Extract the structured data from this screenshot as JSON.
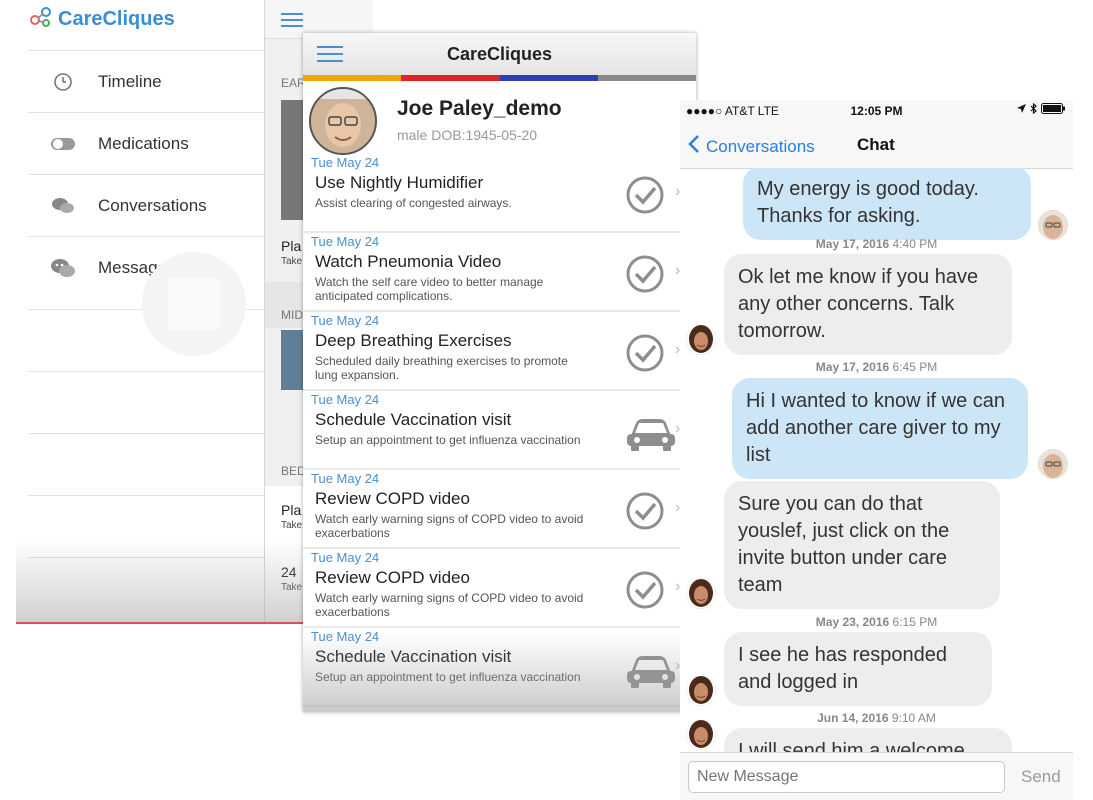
{
  "side_menu": {
    "brand": "CareCliques",
    "items": [
      {
        "label": "Timeline",
        "icon": "clock-icon"
      },
      {
        "label": "Medications",
        "icon": "toggle-icon"
      },
      {
        "label": "Conversations",
        "icon": "chat-bubbles-icon"
      },
      {
        "label": "Messages",
        "icon": "wechat-icon"
      }
    ],
    "background_page": {
      "sections": [
        "EAR",
        "MID",
        "BED"
      ],
      "rows": [
        {
          "title": "Pla",
          "sub": "Take"
        },
        {
          "title": "Pla",
          "sub": "Take"
        },
        {
          "title": "24",
          "sub": "Take"
        }
      ]
    }
  },
  "task_screen": {
    "title": "CareCliques",
    "stripe_colors": [
      "#f0a800",
      "#d9262c",
      "#2e3fb3",
      "#8a8a8a"
    ],
    "patient": {
      "name": "Joe Paley_demo",
      "info": "male  DOB:1945-05-20"
    },
    "tasks": [
      {
        "date": "Tue May 24",
        "title": "Use Nightly Humidifier",
        "desc": "Assist clearing of congested airways.",
        "action": "check-icon"
      },
      {
        "date": "Tue May 24",
        "title": "Watch Pneumonia Video",
        "desc": "Watch the self care video to better manage anticipated complications.",
        "action": "check-icon"
      },
      {
        "date": "Tue May 24",
        "title": "Deep Breathing Exercises",
        "desc": "Scheduled daily breathing exercises to promote lung expansion.",
        "action": "check-icon"
      },
      {
        "date": "Tue May 24",
        "title": "Schedule Vaccination visit",
        "desc": "Setup an appointment to get influenza vaccination",
        "action": "car-icon"
      },
      {
        "date": "Tue May 24",
        "title": "Review COPD video",
        "desc": "Watch early warning signs of COPD video to avoid exacerbations",
        "action": "check-icon"
      },
      {
        "date": "Tue May 24",
        "title": "Review COPD video",
        "desc": "Watch early warning signs of COPD video to avoid exacerbations",
        "action": "check-icon"
      },
      {
        "date": "Tue May 24",
        "title": "Schedule Vaccination visit",
        "desc": "Setup an appointment to get influenza vaccination",
        "action": "car-icon"
      }
    ]
  },
  "chat": {
    "status": {
      "carrier": "●●●●○ AT&T  LTE",
      "time": "12:05 PM"
    },
    "back_label": "Conversations",
    "title": "Chat",
    "messages": [
      {
        "dir": "out",
        "text": "My energy is good today. Thanks for asking."
      },
      {
        "stamp_date": "May 17, 2016",
        "stamp_time": "4:40 PM"
      },
      {
        "dir": "in",
        "text": "Ok let me know if you have any other concerns. Talk tomorrow."
      },
      {
        "stamp_date": "May 17, 2016",
        "stamp_time": "6:45 PM"
      },
      {
        "dir": "out",
        "text": "Hi I wanted to know if we can add another care giver to my list"
      },
      {
        "dir": "in",
        "text": "Sure you can do that youslef, just click on the invite button under care team"
      },
      {
        "stamp_date": "May 23, 2016",
        "stamp_time": "6:15 PM"
      },
      {
        "dir": "in",
        "text": "I see he has responded and logged in"
      },
      {
        "stamp_date": "Jun 14, 2016",
        "stamp_time": "9:10 AM"
      },
      {
        "dir": "in",
        "text": "I will send him a welcome"
      }
    ],
    "input_placeholder": "New Message",
    "send_label": "Send"
  }
}
